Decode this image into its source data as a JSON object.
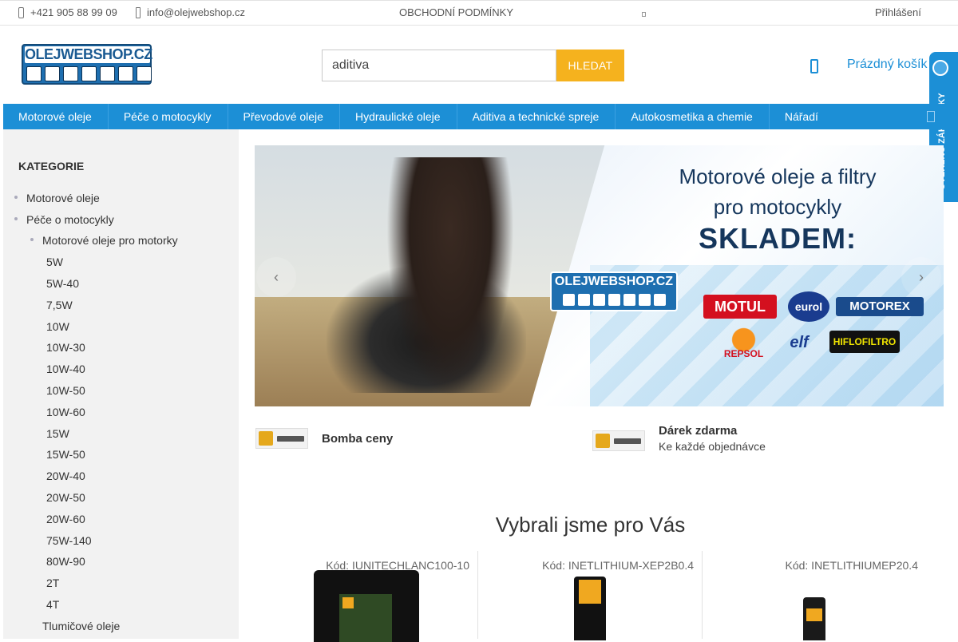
{
  "topbar": {
    "phone": "+421 905 88 99 09",
    "email": "info@olejwebshop.cz",
    "terms": "OBCHODNÍ PODMÍNKY",
    "login": "Přihlášení"
  },
  "header": {
    "logo_text": "OLEJWEBSHOP.CZ",
    "search_placeholder": "aditiva",
    "search_value": "aditiva",
    "search_button": "HLEDAT",
    "cart_label": "Prázdný košík",
    "verified_badge": "OVĚŘENO ZÁKAZNÍKY"
  },
  "nav": {
    "items": [
      "Motorové oleje",
      "Péče o motocykly",
      "Převodové oleje",
      "Hydraulické oleje",
      "Aditiva a technické spreje",
      "Autokosmetika a chemie",
      "Nářadí"
    ]
  },
  "sidebar": {
    "title": "KATEGORIE",
    "items": [
      "Motorové oleje",
      "Péče o motocykly",
      "Motorové oleje pro motorky",
      "5W",
      "5W-40",
      "7,5W",
      "10W",
      "10W-30",
      "10W-40",
      "10W-50",
      "10W-60",
      "15W",
      "15W-50",
      "20W-40",
      "20W-50",
      "20W-60",
      "75W-140",
      "80W-90",
      "2T",
      "4T",
      "Tlumičové oleje"
    ]
  },
  "banner": {
    "line1": "Motorové oleje a filtry",
    "line2": "pro motocykly",
    "line3": "SKLADEM:",
    "logo_text": "OLEJWEBSHOP.CZ",
    "brands": [
      "MOTUL",
      "eurol",
      "MOTOREX",
      "REPSOL",
      "elf",
      "HIFLOFILTRO"
    ],
    "prev_arrow": "‹",
    "next_arrow": "›"
  },
  "promos": [
    {
      "title": "Bomba ceny",
      "subtitle": ""
    },
    {
      "title": "Dárek zdarma",
      "subtitle": "Ke každé objednávce"
    }
  ],
  "section_title": "Vybrali jsme pro Vás",
  "products": [
    {
      "code": "Kód: IUNITECHLANC100-10"
    },
    {
      "code": "Kód: INETLITHIUM-XEP2B0.4"
    },
    {
      "code": "Kód: INETLITHIUMEP20.4"
    }
  ],
  "colors": {
    "primary": "#1c8fd6",
    "search_button": "#f5b21e",
    "sidebar_bg": "#f2f2f2"
  }
}
